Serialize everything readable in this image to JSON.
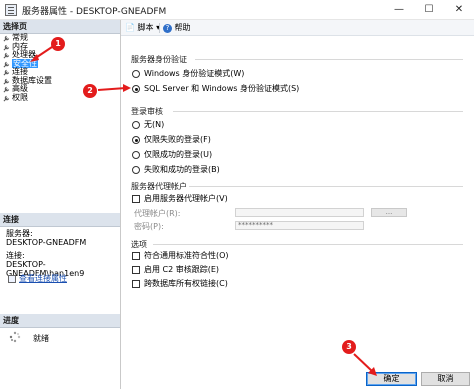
{
  "window": {
    "title": "服务器属性 - DESKTOP-GNEADFM",
    "minimize": "—",
    "maximize": "☐",
    "close": "✕"
  },
  "sidebar": {
    "header": "选择页",
    "items": [
      {
        "label": "常规"
      },
      {
        "label": "内存"
      },
      {
        "label": "处理器"
      },
      {
        "label": "安全性",
        "selected": true
      },
      {
        "label": "连接"
      },
      {
        "label": "数据库设置"
      },
      {
        "label": "高级"
      },
      {
        "label": "权限"
      }
    ],
    "connection_header": "连接",
    "server_label": "服务器:",
    "server_value": "DESKTOP-GNEADFM",
    "conn_label": "连接:",
    "conn_value": "DESKTOP-GNEADFM\\han1en9",
    "view_link": "查看连接属性",
    "progress_header": "进度",
    "progress_status": "就绪"
  },
  "toolbar": {
    "script": "脚本",
    "script_arrow": "▾",
    "help": "帮助"
  },
  "auth": {
    "label": "服务器身份验证",
    "windows_only": "Windows 身份验证模式(W)",
    "mixed": "SQL Server 和 Windows 身份验证模式(S)",
    "selected": "mixed"
  },
  "audit": {
    "label": "登录审核",
    "none": "无(N)",
    "failed_only": "仅限失败的登录(F)",
    "success_only": "仅限成功的登录(U)",
    "both": "失败和成功的登录(B)",
    "selected": "failed_only"
  },
  "proxy": {
    "label": "服务器代理帐户",
    "enable": "启用服务器代理帐户(V)",
    "account_label": "代理帐户(R):",
    "account_value": "",
    "password_label": "密码(P):",
    "password_value": "**********",
    "browse": "..."
  },
  "options": {
    "label": "选项",
    "common_criteria": "符合通用标准符合性(O)",
    "c2_audit": "启用 C2 审核跟踪(E)",
    "cross_db": "跨数据库所有权链接(C)"
  },
  "buttons": {
    "ok": "确定",
    "cancel": "取消"
  },
  "annotations": {
    "marker1": "1",
    "marker2": "2",
    "marker3": "3",
    "color": "#e31c1c"
  },
  "colors": {
    "selection": "#3399ff",
    "section_header_bg": "#dce3ec",
    "link": "#1a4fb0"
  }
}
